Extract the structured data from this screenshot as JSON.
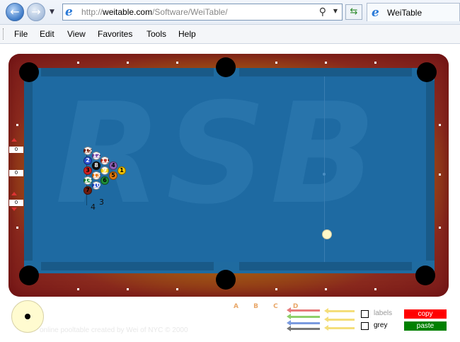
{
  "browser": {
    "back_icon": "back-arrow-icon",
    "forward_icon": "forward-arrow-icon",
    "address": {
      "scheme": "http://",
      "host": "weitable.com",
      "path": "/Software/WeiTable/"
    },
    "tab_title": "WeiTable",
    "menu": [
      "File",
      "Edit",
      "View",
      "Favorites",
      "Tools",
      "Help"
    ]
  },
  "table": {
    "watermark": "RSB",
    "side_counters": [
      "0",
      "0",
      "0"
    ],
    "rack_labels": {
      "left": "4",
      "right": "3"
    },
    "balls": [
      {
        "n": "1",
        "color": "#f2c200"
      },
      {
        "n": "11",
        "color": "#c0392b"
      },
      {
        "n": "4",
        "color": "#8e5fb5"
      },
      {
        "n": "9",
        "color": "#f3d31a"
      },
      {
        "n": "5",
        "color": "#e07a10"
      },
      {
        "n": "6",
        "color": "#1e8f3a"
      },
      {
        "n": "15",
        "color": "#7a2410"
      },
      {
        "n": "8",
        "color": "#111111"
      },
      {
        "n": "2",
        "color": "#2a4fd0"
      },
      {
        "n": "13",
        "color": "#e8781a"
      },
      {
        "n": "3",
        "color": "#d12020"
      },
      {
        "n": "12",
        "color": "#7d4fb0"
      },
      {
        "n": "10",
        "color": "#2a4fd0"
      },
      {
        "n": "14",
        "color": "#1e8f3a"
      },
      {
        "n": "7",
        "color": "#6e1c10"
      }
    ]
  },
  "controls": {
    "credit": "online pooltable created by Wei of NYC © 2000",
    "positions": "A B C D",
    "checkbox_labels": "labels",
    "checkbox_grey": "grey",
    "copy": "copy",
    "paste": "paste",
    "colors": {
      "copy": "#ff0000",
      "paste": "#008000"
    }
  }
}
